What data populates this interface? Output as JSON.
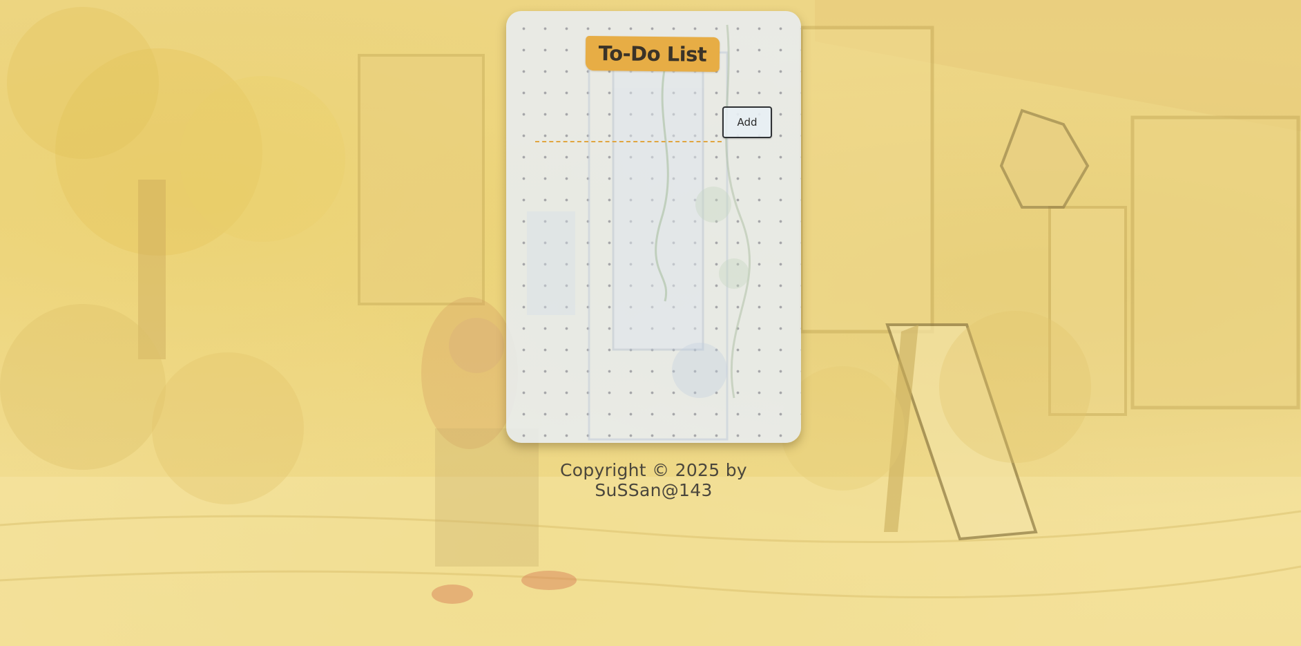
{
  "app": {
    "title": "To-Do List"
  },
  "input": {
    "value": "",
    "placeholder": ""
  },
  "add_button": {
    "label": "Add"
  },
  "tasks": [],
  "footer": {
    "copyright": "Copyright © 2025 by SuSSan@143"
  },
  "colors": {
    "title_tag": "#e7ad45",
    "input_underline": "#e0a53f",
    "card_background": "#e8eef5",
    "page_background": "#f2dd8e",
    "text": "#3a3328"
  },
  "icons": {
    "background": "cafe-storefront-illustration"
  }
}
